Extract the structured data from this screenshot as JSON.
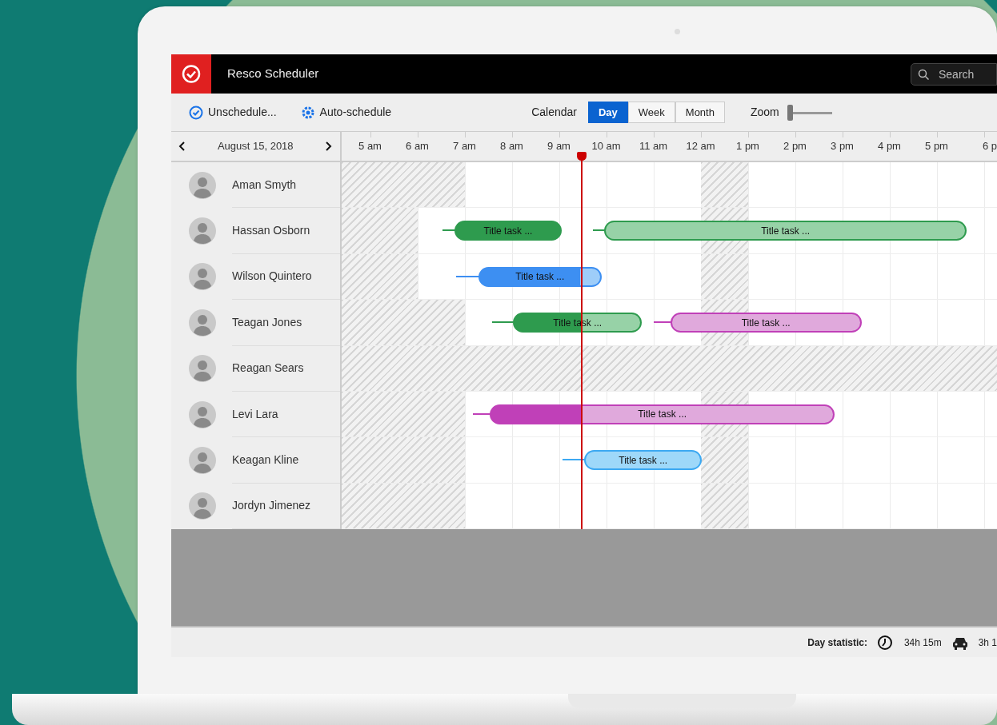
{
  "app": {
    "title": "Resco Scheduler",
    "search": {
      "placeholder": "Search"
    }
  },
  "toolbar": {
    "actions": [
      {
        "kind": "check",
        "label": "Unschedule..."
      },
      {
        "kind": "gear",
        "label": "Auto-schedule"
      }
    ],
    "calendar_label": "Calendar",
    "views": [
      {
        "label": "Day",
        "selected": true
      },
      {
        "label": "Week",
        "selected": false
      },
      {
        "label": "Month",
        "selected": false
      }
    ],
    "zoom_label": "Zoom",
    "zoom": {
      "level": 0
    }
  },
  "timeline": {
    "date": "August 15, 2018",
    "hours": [
      "5 am",
      "6 am",
      "7 am",
      "8 am",
      "9 am",
      "10 am",
      "11 am",
      "12 am",
      "1 pm",
      "2 pm",
      "3 pm",
      "4 pm",
      "5 pm",
      "6 p"
    ]
  },
  "resources": [
    {
      "name": "Aman Smyth"
    },
    {
      "name": "Hassan Osborn",
      "tasks": [
        {
          "title": "Title task ...",
          "color": "#2e9b4e"
        },
        {
          "title": "Title task ...",
          "color": "#2e9b4e"
        }
      ]
    },
    {
      "name": "Wilson Quintero",
      "tasks": [
        {
          "title": "Title task ...",
          "color": "#3d8ff2"
        }
      ]
    },
    {
      "name": "Teagan Jones",
      "tasks": [
        {
          "title": "Title task ...",
          "color": "#2e9b4e"
        },
        {
          "title": "Title task ...",
          "color": "#c040b8"
        }
      ]
    },
    {
      "name": "Reagan Sears"
    },
    {
      "name": "Levi Lara",
      "tasks": [
        {
          "title": "Title task ...",
          "color": "#c040b8"
        }
      ]
    },
    {
      "name": "Keagan Kline",
      "tasks": [
        {
          "title": "Title task ...",
          "color": "#3da9f2"
        }
      ]
    },
    {
      "name": "Jordyn Jimenez"
    }
  ],
  "status_bar": {
    "label": "Day statistic:",
    "stats": [
      {
        "kind": "time",
        "value": "34h 15m"
      },
      {
        "kind": "travel",
        "value": "3h 1"
      }
    ]
  }
}
